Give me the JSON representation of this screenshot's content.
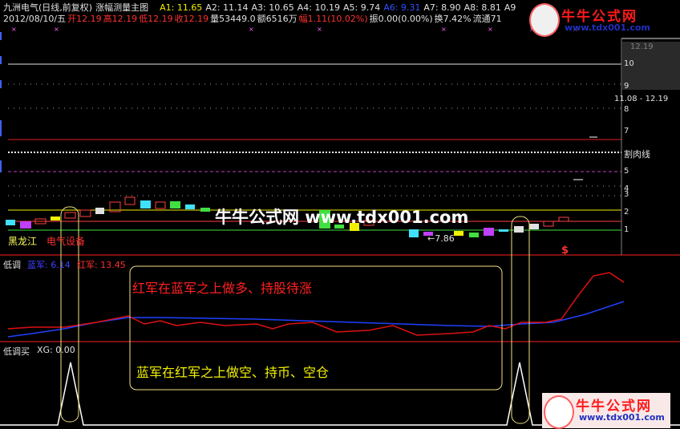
{
  "header": {
    "title": "九洲电气(日线,前复权)",
    "indicator": "涨幅测量主图",
    "ma": [
      {
        "label": "A1: 11.65",
        "color": "#f0f000"
      },
      {
        "label": "A2: 11.14",
        "color": "#e0e0e0"
      },
      {
        "label": "A3: 10.65",
        "color": "#e0e0e0"
      },
      {
        "label": "A4: 10.19",
        "color": "#e0e0e0"
      },
      {
        "label": "A5: 9.74",
        "color": "#e0e0e0"
      },
      {
        "label": "A6: 9.31",
        "color": "#3050ff"
      },
      {
        "label": "A7: 8.90",
        "color": "#e0e0e0"
      },
      {
        "label": "A8: 8.81",
        "color": "#e0e0e0"
      },
      {
        "label": "A9",
        "color": "#e0e0e0"
      }
    ],
    "date": "2012/08/10/五",
    "open": "开12.19",
    "high": "高12.19",
    "low": "低12.19",
    "close": "收12.19",
    "volume": "量53449.0",
    "amount": "额6516万",
    "change": "幅1.11(10.02%)",
    "amplitude": "振0.00(0.00%)",
    "turnover": "换7.42%",
    "float": "流通71"
  },
  "logo": {
    "name": "牛牛公式网",
    "url": "www.tdx001.com"
  },
  "watermark": "牛牛公式网 www.tdx001.com",
  "axis": {
    "ticks": [
      "12.19",
      "10",
      "9",
      "8",
      "7",
      "5",
      "4",
      "3",
      "2",
      "1"
    ],
    "date_range": "11.08 - 12.19",
    "cut_line": "割肉线"
  },
  "annotations": {
    "stock_name": "黑龙江",
    "sector": "电气设备",
    "low_price": "←7.86",
    "dollar": "$"
  },
  "pane1": {
    "title": "低调",
    "blue_label": "蓝军: 6.14",
    "red_label": "红军: 13.45"
  },
  "pane2": {
    "title": "低调买",
    "xg_label": "XG: 0.00"
  },
  "notes": {
    "red_note": "红军在蓝军之上做多、持股待涨",
    "yellow_note": "蓝军在红军之上做空、持币、空仓"
  }
}
